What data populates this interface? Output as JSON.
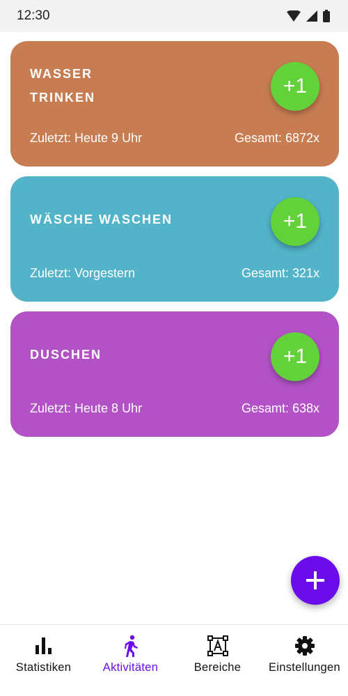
{
  "status_bar": {
    "time": "12:30",
    "icons": [
      "wifi-icon",
      "cellular-signal-icon",
      "battery-icon"
    ]
  },
  "activities": [
    {
      "title": "WASSER\nTRINKEN",
      "last": "Zuletzt: Heute 9 Uhr",
      "total": "Gesamt: 6872x",
      "button_label": "+1",
      "color": "#c87c51"
    },
    {
      "title": "WÄSCHE WASCHEN",
      "last": "Zuletzt: Vorgestern",
      "total": "Gesamt: 321x",
      "button_label": "+1",
      "color": "#52b3c9"
    },
    {
      "title": "DUSCHEN",
      "last": "Zuletzt: Heute 8 Uhr",
      "total": "Gesamt: 638x",
      "button_label": "+1",
      "color": "#b352c7"
    }
  ],
  "fab": {
    "icon": "plus-icon",
    "color": "#6a0dea"
  },
  "bottom_nav": {
    "items": [
      {
        "label": "Statistiken",
        "icon": "bar-chart-icon",
        "active": false
      },
      {
        "label": "Aktivitäten",
        "icon": "walking-person-icon",
        "active": true
      },
      {
        "label": "Bereiche",
        "icon": "text-frame-icon",
        "active": false
      },
      {
        "label": "Einstellungen",
        "icon": "gear-icon",
        "active": false
      }
    ],
    "active_color": "#6a0dea"
  },
  "colors": {
    "plus_button": "#62d13a",
    "status_bar_bg": "#f2f2f2"
  }
}
